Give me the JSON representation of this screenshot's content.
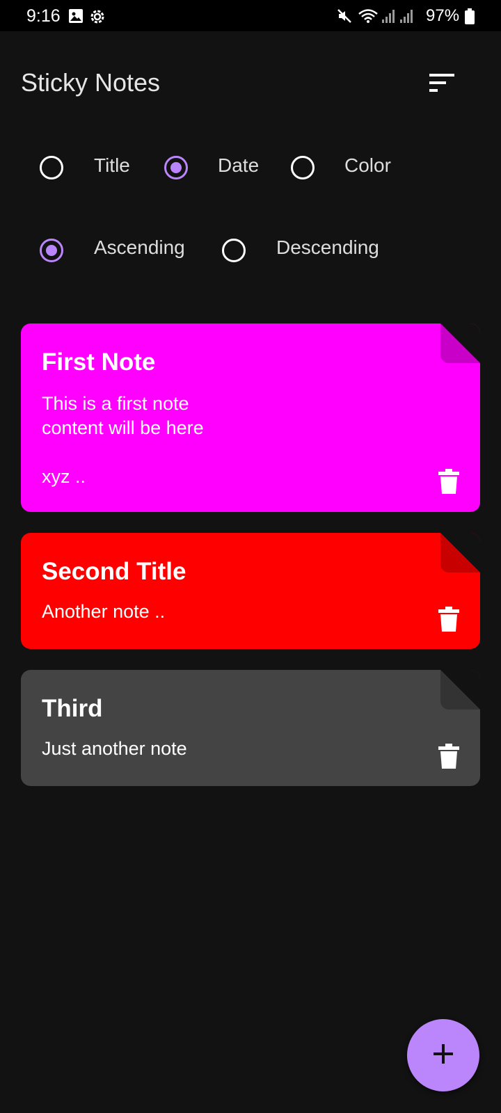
{
  "status_bar": {
    "time": "9:16",
    "battery": "97%"
  },
  "app": {
    "title": "Sticky Notes",
    "sort_icon": "sort-icon"
  },
  "sort_by": {
    "options": [
      {
        "label": "Title",
        "checked": false
      },
      {
        "label": "Date",
        "checked": true
      },
      {
        "label": "Color",
        "checked": false
      }
    ]
  },
  "order": {
    "options": [
      {
        "label": "Ascending",
        "checked": true
      },
      {
        "label": "Descending",
        "checked": false
      }
    ]
  },
  "notes": [
    {
      "title": "First Note",
      "content": "This is a first note\ncontent will be here",
      "extra": "xyz ..",
      "color": "#ff00ff"
    },
    {
      "title": "Second Title",
      "content": "Another note ..",
      "color": "#ff0000"
    },
    {
      "title": "Third",
      "content": "Just another note",
      "color": "#444444"
    }
  ],
  "fab": {
    "icon": "plus-icon"
  },
  "colors": {
    "accent": "#bb86fc",
    "background": "#121212"
  }
}
